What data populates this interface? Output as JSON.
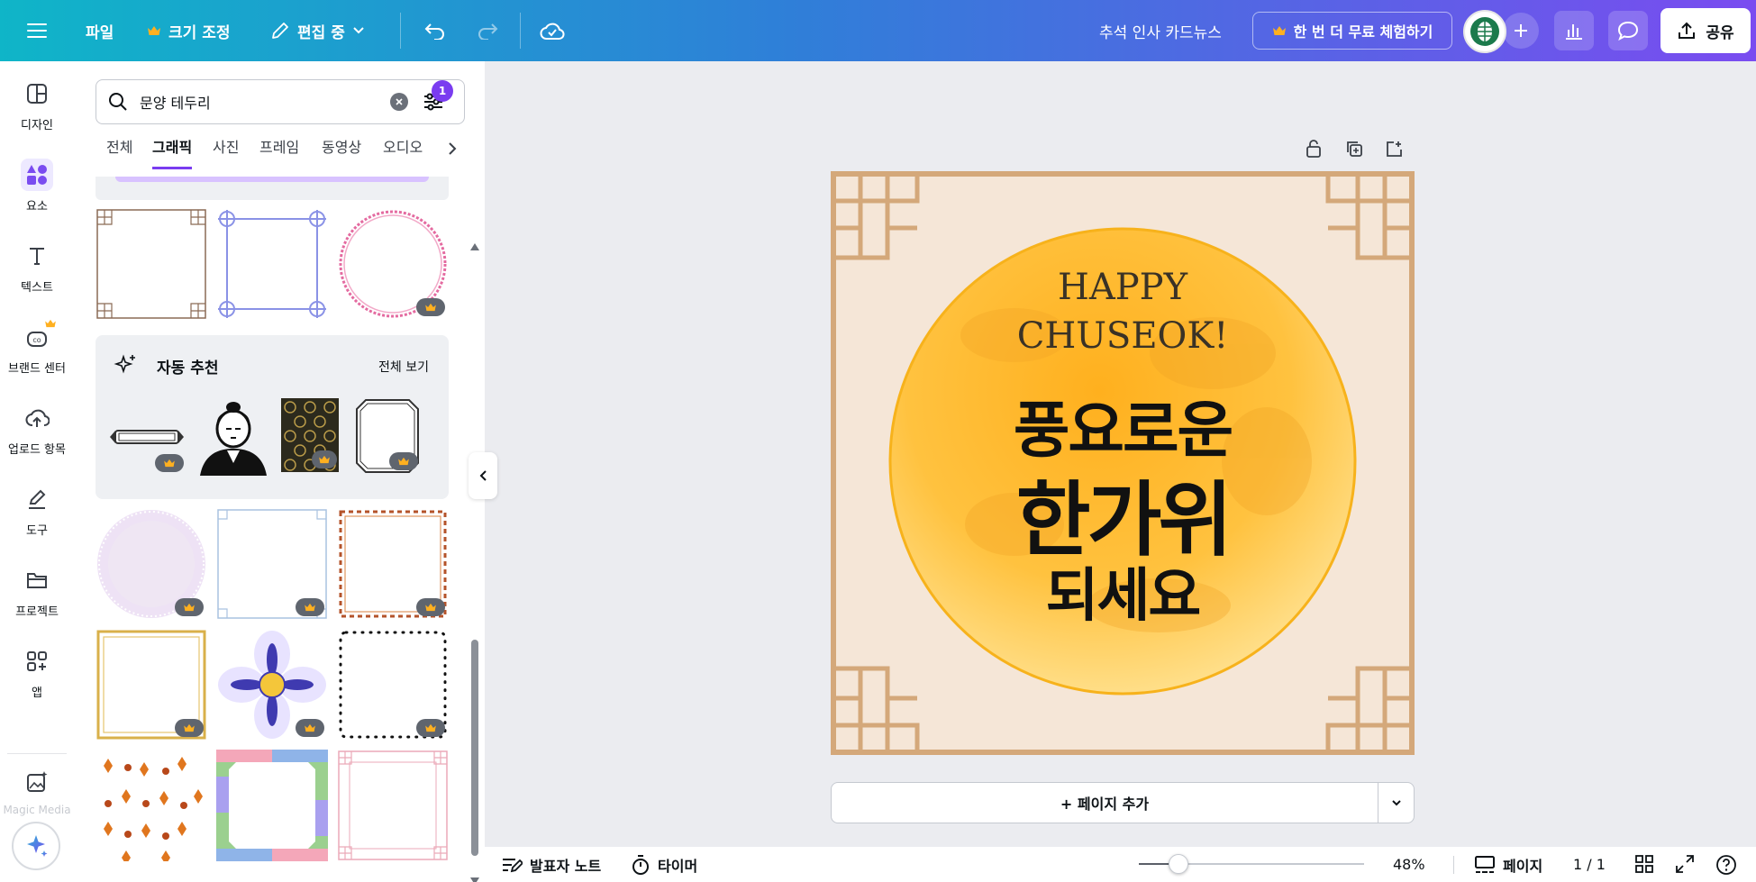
{
  "topbar": {
    "menu_icon": "hamburger-icon",
    "file_label": "파일",
    "resize_label": "크기 조정",
    "edit_mode_label": "편집 중",
    "doc_title": "추석 인사 카드뉴스",
    "trial_label": "한 번 더 무료 체험하기",
    "share_label": "공유",
    "accent_colors": [
      "#0fb5c8",
      "#7a4cf0"
    ]
  },
  "rail": {
    "items": [
      {
        "label": "디자인",
        "icon": "design-icon"
      },
      {
        "label": "요소",
        "icon": "elements-icon"
      },
      {
        "label": "텍스트",
        "icon": "text-icon"
      },
      {
        "label": "브랜드 센터",
        "icon": "brand-icon"
      },
      {
        "label": "업로드 항목",
        "icon": "upload-icon"
      },
      {
        "label": "도구",
        "icon": "tools-icon"
      },
      {
        "label": "프로젝트",
        "icon": "folder-icon"
      },
      {
        "label": "앱",
        "icon": "apps-icon"
      },
      {
        "label": "Magic Media",
        "icon": "magic-media-icon"
      }
    ]
  },
  "panel": {
    "search_value": "문양 테두리",
    "filter_badge": "1",
    "tabs": [
      "전체",
      "그래픽",
      "사진",
      "프레임",
      "동영상",
      "오디오"
    ],
    "active_tab": "그래픽",
    "auto_recommend_title": "자동 추천",
    "see_all_label": "전체 보기"
  },
  "canvas": {
    "card_text_en_line1": "HAPPY",
    "card_text_en_line2": "CHUSEOK!",
    "card_text_ko_line1": "풍요로운",
    "card_text_ko_line2": "한가위",
    "card_text_ko_line3": "되세요",
    "add_page_label": "+ 페이지 추가"
  },
  "bottombar": {
    "notes_label": "발표자 노트",
    "timer_label": "타이머",
    "zoom_percent": 48,
    "zoom_label": "48%",
    "pages_label": "페이지",
    "page_count": "1 / 1"
  }
}
